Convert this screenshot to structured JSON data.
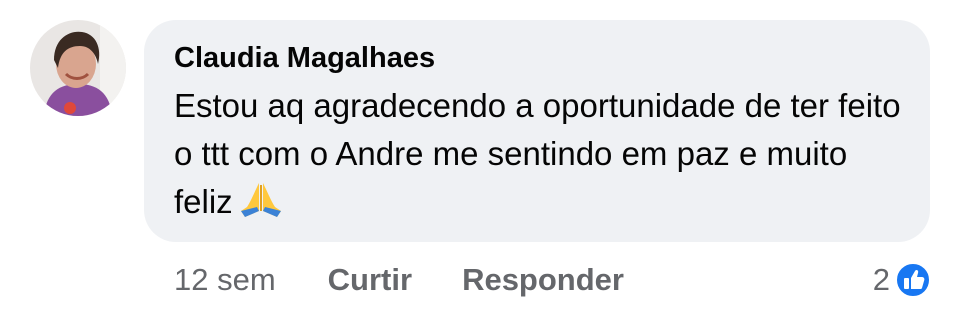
{
  "comment": {
    "author": "Claudia Magalhaes",
    "text": "Estou aq agradecendo a oportunidade de ter feito o ttt com o Andre me sentindo em paz e muito feliz",
    "emoji": "🙏",
    "timestamp": "12 sem",
    "like_label": "Curtir",
    "reply_label": "Responder",
    "reaction_count": "2",
    "reaction_icon": "thumbs-up-icon"
  },
  "colors": {
    "bubble": "#eff1f4",
    "text": "#050505",
    "meta": "#65676b",
    "like_blue": "#1877f2"
  }
}
